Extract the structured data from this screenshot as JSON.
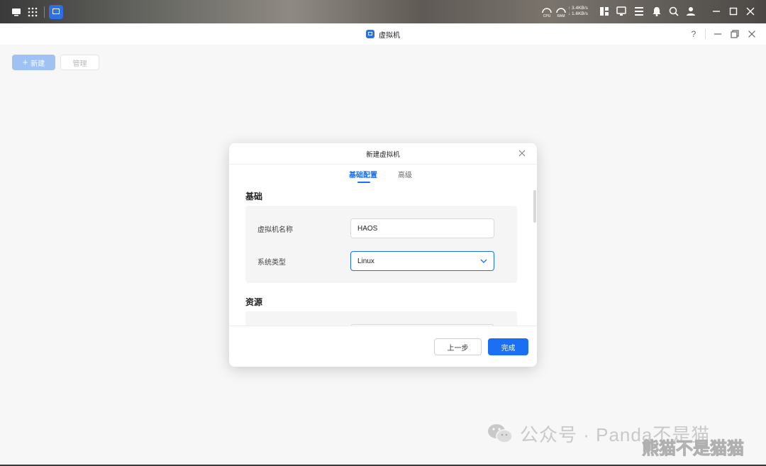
{
  "taskbar": {
    "icons": [
      "desktop-icon",
      "apps-grid-icon",
      "vm-app-icon",
      "bell-icon",
      "search-icon",
      "user-icon"
    ],
    "cpu_label": "CPU",
    "ram_label": "RAM",
    "upload": "↑ 3.4KB/s",
    "download": "↓ 1.6KB/s"
  },
  "window": {
    "title": "虚拟机",
    "help": "?",
    "accent": "#1a6ff5"
  },
  "toolbar": {
    "new_label": "新建",
    "manage_label": "管理"
  },
  "dialog": {
    "title": "新建虚拟机",
    "tabs": [
      {
        "label": "基础配置",
        "active": true
      },
      {
        "label": "高级",
        "active": false
      }
    ],
    "sections": {
      "basic": {
        "title": "基础",
        "name_label": "虚拟机名称",
        "name_value": "HAOS",
        "os_label": "系统类型",
        "os_value": "Linux"
      },
      "resources": {
        "title": "资源"
      }
    },
    "prev_label": "上一步",
    "done_label": "完成"
  },
  "watermark": {
    "text": "公众号 · Panda不是猫",
    "overlay_text": "熊猫不是猫猫"
  }
}
